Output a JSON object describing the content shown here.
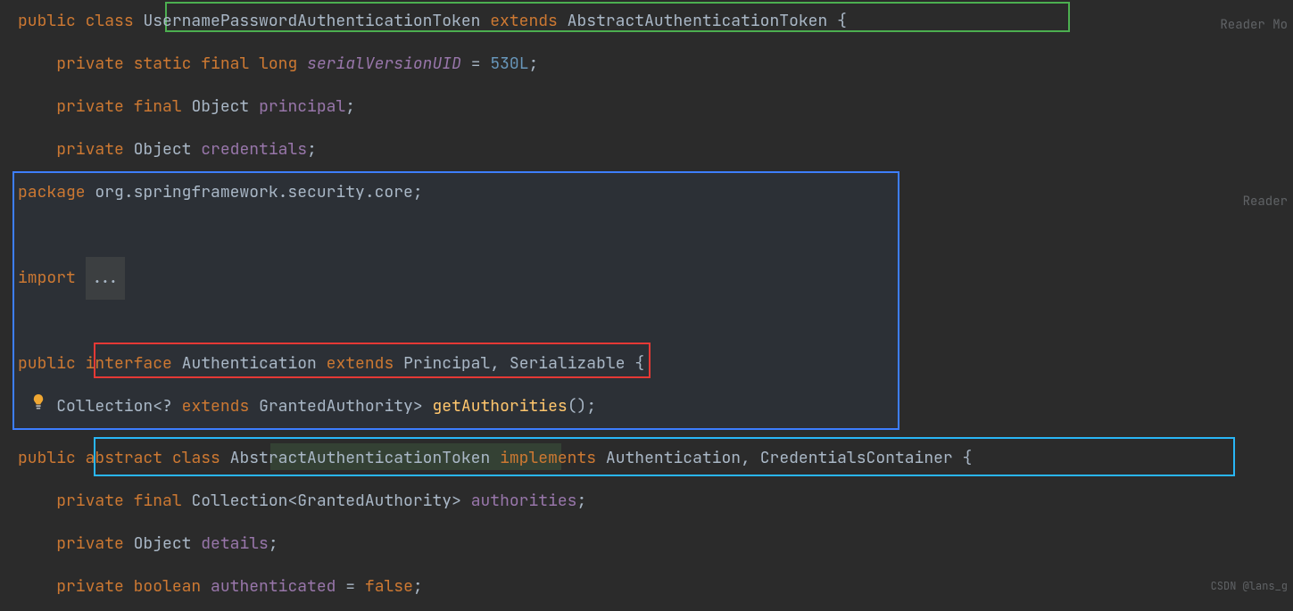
{
  "overlays": {
    "reader1": "Reader Mo",
    "reader2": "Reader "
  },
  "watermark": "CSDN @lans_g",
  "gutter": {
    "fold1": "",
    "fold2": ""
  },
  "kw": {
    "public": "public",
    "class": "class",
    "extends": "extends",
    "private": "private",
    "static": "static",
    "final": "final",
    "long": "long",
    "package": "package",
    "import": "import",
    "interface": "interface",
    "abstract": "abstract",
    "implements": "implements",
    "boolean": "boolean",
    "false": "false"
  },
  "punct": {
    "lbrace": "{",
    "semi": ";",
    "comma": ",",
    "lparen": "(",
    "rparen": ")",
    "eq": "=",
    "lt": "<",
    "gt": ">",
    "q": "?",
    "ellipsis": "..."
  },
  "line1": {
    "className": "UsernamePasswordAuthenticationToken",
    "superClass": "AbstractAuthenticationToken"
  },
  "line2": {
    "field": "serialVersionUID",
    "value": "530L"
  },
  "line3": {
    "type": "Object",
    "field": "principal"
  },
  "line4": {
    "type": "Object",
    "field": "credentials"
  },
  "line5": {
    "pkg": "org.springframework.security.core"
  },
  "line7": {
    "iface": "Authentication",
    "superIface": "Principal",
    "other": "Serializable"
  },
  "line8": {
    "coll": "Collection",
    "granted": "GrantedAuthority",
    "method": "getAuthorities"
  },
  "line9": {
    "className": "AbstractAuthenticationToken",
    "iface1": "Authentication",
    "iface2": "CredentialsContainer"
  },
  "line10": {
    "coll": "Collection",
    "granted": "GrantedAuthority",
    "field": "authorities"
  },
  "line11": {
    "type": "Object",
    "field": "details"
  },
  "line12": {
    "field": "authenticated"
  }
}
